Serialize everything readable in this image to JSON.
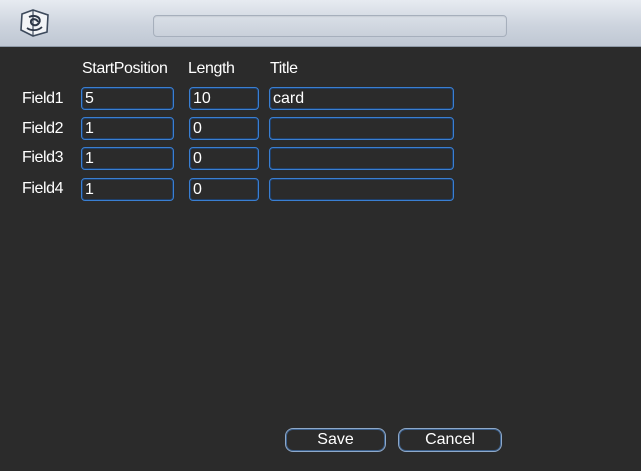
{
  "columns": {
    "start_position": "StartPosition",
    "length": "Length",
    "title": "Title"
  },
  "rows": [
    {
      "label": "Field1",
      "start_position": "5",
      "length": "10",
      "title": "card"
    },
    {
      "label": "Field2",
      "start_position": "1",
      "length": "0",
      "title": ""
    },
    {
      "label": "Field3",
      "start_position": "1",
      "length": "0",
      "title": ""
    },
    {
      "label": "Field4",
      "start_position": "1",
      "length": "0",
      "title": ""
    }
  ],
  "buttons": {
    "save": "Save",
    "cancel": "Cancel"
  },
  "icons": {
    "app": "app-logo-icon"
  },
  "colors": {
    "background": "#2b2b2b",
    "field_border": "#3a7fd2",
    "text": "#ffffff"
  }
}
